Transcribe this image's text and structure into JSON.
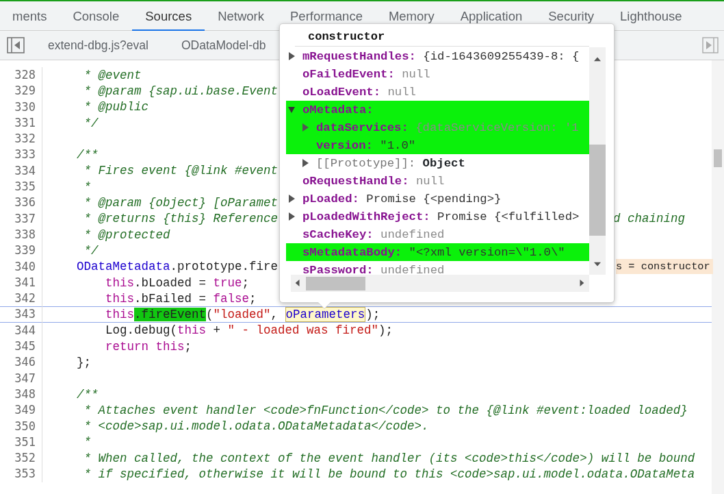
{
  "tabs": [
    {
      "label": "ments",
      "selected": false
    },
    {
      "label": "Console",
      "selected": false
    },
    {
      "label": "Sources",
      "selected": true
    },
    {
      "label": "Network",
      "selected": false
    },
    {
      "label": "Performance",
      "selected": false
    },
    {
      "label": "Memory",
      "selected": false
    },
    {
      "label": "Application",
      "selected": false
    },
    {
      "label": "Security",
      "selected": false
    },
    {
      "label": "Lighthouse",
      "selected": false
    }
  ],
  "file_tabs": [
    {
      "label": "extend-dbg.js?eval"
    },
    {
      "label": "ODataModel-db"
    }
  ],
  "code_lines": [
    {
      "number": "328",
      "current": false,
      "segments": [
        {
          "text": "     * @event",
          "kind": "comment"
        }
      ]
    },
    {
      "number": "329",
      "current": false,
      "segments": [
        {
          "text": "     * @param {sap.ui.base.Event",
          "kind": "comment"
        }
      ]
    },
    {
      "number": "330",
      "current": false,
      "segments": [
        {
          "text": "     * @public",
          "kind": "comment"
        }
      ]
    },
    {
      "number": "331",
      "current": false,
      "segments": [
        {
          "text": "     */",
          "kind": "comment"
        }
      ]
    },
    {
      "number": "332",
      "current": false
    },
    {
      "number": "333",
      "current": false,
      "segments": [
        {
          "text": "    /**",
          "kind": "comment"
        }
      ]
    },
    {
      "number": "334",
      "current": false,
      "segments": [
        {
          "text": "     * Fires event {@link #event",
          "kind": "comment"
        }
      ]
    },
    {
      "number": "335",
      "current": false,
      "segments": [
        {
          "text": "     *",
          "kind": "comment"
        }
      ]
    },
    {
      "number": "336",
      "current": false,
      "segments": [
        {
          "text": "     * @param {object} [oParamet",
          "kind": "comment"
        }
      ]
    },
    {
      "number": "337",
      "current": false,
      "segments": [
        {
          "text": "     * @returns {this} Reference",
          "kind": "comment"
        }
      ],
      "right": [
        {
          "text": "d chaining",
          "kind": "comment"
        }
      ]
    },
    {
      "number": "338",
      "current": false,
      "segments": [
        {
          "text": "     * @protected",
          "kind": "comment"
        }
      ]
    },
    {
      "number": "339",
      "current": false,
      "segments": [
        {
          "text": "     */",
          "kind": "comment"
        }
      ]
    },
    {
      "number": "340",
      "current": false,
      "segments": [
        {
          "text": "    ODataMetadata",
          "kind": "class"
        },
        {
          "text": ".prototype.fire",
          "kind": "plain"
        }
      ],
      "right": [
        {
          "text": "s = constructor",
          "kind": "hint"
        }
      ]
    },
    {
      "number": "341",
      "current": false,
      "segments": [
        {
          "text": "        this",
          "kind": "keyword"
        },
        {
          "text": ".bLoaded = ",
          "kind": "plain"
        },
        {
          "text": "true",
          "kind": "keyword"
        },
        {
          "text": ";",
          "kind": "plain"
        }
      ]
    },
    {
      "number": "342",
      "current": false,
      "segments": [
        {
          "text": "        this",
          "kind": "keyword"
        },
        {
          "text": ".bFailed = ",
          "kind": "plain"
        },
        {
          "text": "false",
          "kind": "keyword"
        },
        {
          "text": ";",
          "kind": "plain"
        }
      ]
    },
    {
      "number": "343",
      "current": true,
      "segments": [
        {
          "text": "        this",
          "kind": "keyword"
        },
        {
          "text": ".fireEvent",
          "kind": "match"
        },
        {
          "text": "(",
          "kind": "plain"
        },
        {
          "text": "\"loaded\"",
          "kind": "string"
        },
        {
          "text": ", ",
          "kind": "plain"
        },
        {
          "text": "oParameters",
          "kind": "hover"
        },
        {
          "text": ");",
          "kind": "plain"
        }
      ]
    },
    {
      "number": "344",
      "current": false,
      "segments": [
        {
          "text": "        Log.debug(",
          "kind": "plain"
        },
        {
          "text": "this",
          "kind": "keyword"
        },
        {
          "text": " + ",
          "kind": "plain"
        },
        {
          "text": "\" - loaded was fired\"",
          "kind": "string"
        },
        {
          "text": ");",
          "kind": "plain"
        }
      ]
    },
    {
      "number": "345",
      "current": false,
      "segments": [
        {
          "text": "        return this",
          "kind": "keyword"
        },
        {
          "text": ";",
          "kind": "plain"
        }
      ]
    },
    {
      "number": "346",
      "current": false,
      "segments": [
        {
          "text": "    };",
          "kind": "plain"
        }
      ]
    },
    {
      "number": "347",
      "current": false
    },
    {
      "number": "348",
      "current": false,
      "segments": [
        {
          "text": "    /**",
          "kind": "comment"
        }
      ]
    },
    {
      "number": "349",
      "current": false,
      "segments": [
        {
          "text": "     * Attaches event handler <code>fnFunction</code> to the {@link #event:loaded loaded}",
          "kind": "comment"
        }
      ]
    },
    {
      "number": "350",
      "current": false,
      "segments": [
        {
          "text": "     * <code>sap.ui.model.odata.ODataMetadata</code>.",
          "kind": "comment"
        }
      ]
    },
    {
      "number": "351",
      "current": false,
      "segments": [
        {
          "text": "     *",
          "kind": "comment"
        }
      ]
    },
    {
      "number": "352",
      "current": false,
      "segments": [
        {
          "text": "     * When called, the context of the event handler (its <code>this</code>) will be bound",
          "kind": "comment"
        }
      ]
    },
    {
      "number": "353",
      "current": false,
      "segments": [
        {
          "text": "     * if specified, otherwise it will be bound to this <code>sap.ui.model.odata.ODataMeta",
          "kind": "comment"
        }
      ]
    }
  ],
  "popover": {
    "title": "constructor",
    "rows": [
      {
        "key": "mRequestHandles:",
        "value": "{id-1643609255439-8: {",
        "dim": false,
        "kind": "property",
        "expanded": false,
        "highlighted": false
      },
      {
        "key": "oFailedEvent:",
        "value": "null",
        "dim": true,
        "kind": "property",
        "highlighted": false
      },
      {
        "key": "oLoadEvent:",
        "value": "null",
        "dim": true,
        "kind": "property",
        "highlighted": false
      },
      {
        "key": "oMetadata:",
        "kind": "property",
        "expanded": true,
        "highlighted": true,
        "children": [
          {
            "key": "dataServices:",
            "value": "{dataServiceVersion: '1",
            "dim": true,
            "kind": "property",
            "expanded": false,
            "highlighted": true
          },
          {
            "key": "version:",
            "value": "\"1.0\"",
            "dim": false,
            "kind": "property",
            "highlighted": true
          },
          {
            "key": "[[Prototype]]:",
            "value": "Object",
            "dim": false,
            "kind": "internal",
            "expanded": false,
            "highlighted": false
          }
        ]
      },
      {
        "key": "oRequestHandle:",
        "value": "null",
        "dim": true,
        "kind": "property",
        "highlighted": false
      },
      {
        "key": "pLoaded:",
        "value": "Promise {<pending>}",
        "dim": false,
        "kind": "property",
        "expanded": false,
        "highlighted": false
      },
      {
        "key": "pLoadedWithReject:",
        "value": "Promise {<fulfilled>",
        "dim": false,
        "kind": "property",
        "expanded": false,
        "highlighted": false
      },
      {
        "key": "sCacheKey:",
        "value": "undefined",
        "dim": true,
        "kind": "property",
        "highlighted": false
      },
      {
        "key": "sMetadataBody:",
        "value": "\"<?xml version=\\\"1.0\\\"",
        "dim": false,
        "kind": "property",
        "highlighted": true
      },
      {
        "key": "sPassword:",
        "value": "undefined",
        "dim": true,
        "kind": "property",
        "highlighted": false
      }
    ]
  }
}
